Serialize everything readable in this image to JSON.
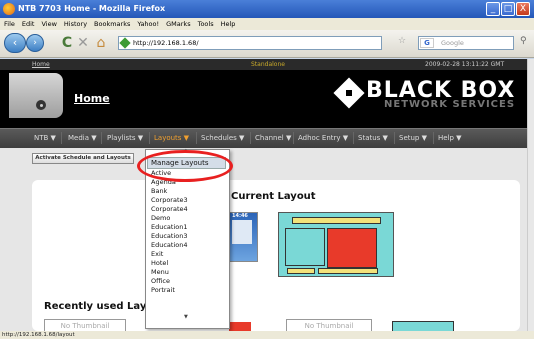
{
  "window": {
    "title": "NTB 7703 Home - Mozilla Firefox",
    "minimize": "_",
    "maximize": "□",
    "close": "X"
  },
  "menubar": [
    "File",
    "Edit",
    "View",
    "History",
    "Bookmarks",
    "Yahoo!",
    "GMarks",
    "Tools",
    "Help"
  ],
  "browser": {
    "url": "http://192.168.1.68/",
    "search_placeholder": "Google",
    "back": "‹",
    "forward": "›",
    "reload": "C",
    "stop": "✕",
    "home": "⌂",
    "status": "http://192.168.1.68/layout"
  },
  "topstrip": {
    "home": "Home",
    "mode": "Standalone",
    "clock": "2009-02-28 13:11:22 GMT"
  },
  "header": {
    "title": "Home",
    "logo": "BLACK BOX",
    "logo_sub": "NETWORK SERVICES"
  },
  "nav": [
    {
      "label": "NTB ▼"
    },
    {
      "label": "Media ▼"
    },
    {
      "label": "Playlists ▼"
    },
    {
      "label": "Layouts ▼"
    },
    {
      "label": "Schedules ▼"
    },
    {
      "label": "Channel ▼"
    },
    {
      "label": "Adhoc Entry ▼"
    },
    {
      "label": "Status ▼"
    },
    {
      "label": "Setup ▼"
    },
    {
      "label": "Help ▼"
    }
  ],
  "activate_button": "Activate Schedule and Layouts",
  "main": {
    "current_title": "Current Layout",
    "recent_title": "Recently used Layou",
    "thumb_clock": "14:46",
    "no_thumb": "No Thumbnail"
  },
  "dropdown": {
    "selected": "Manage Layouts",
    "items": [
      "Active",
      "Agenda",
      "Bank",
      "Corporate3",
      "Corporate4",
      "Demo",
      "Education1",
      "Education3",
      "Education4",
      "Exit",
      "Hotel",
      "Menu",
      "Office",
      "Portrait"
    ],
    "up": "▲",
    "down": "▼"
  },
  "colors": {
    "active_nav": "#f0a030",
    "highlight_oval": "#e82020"
  }
}
